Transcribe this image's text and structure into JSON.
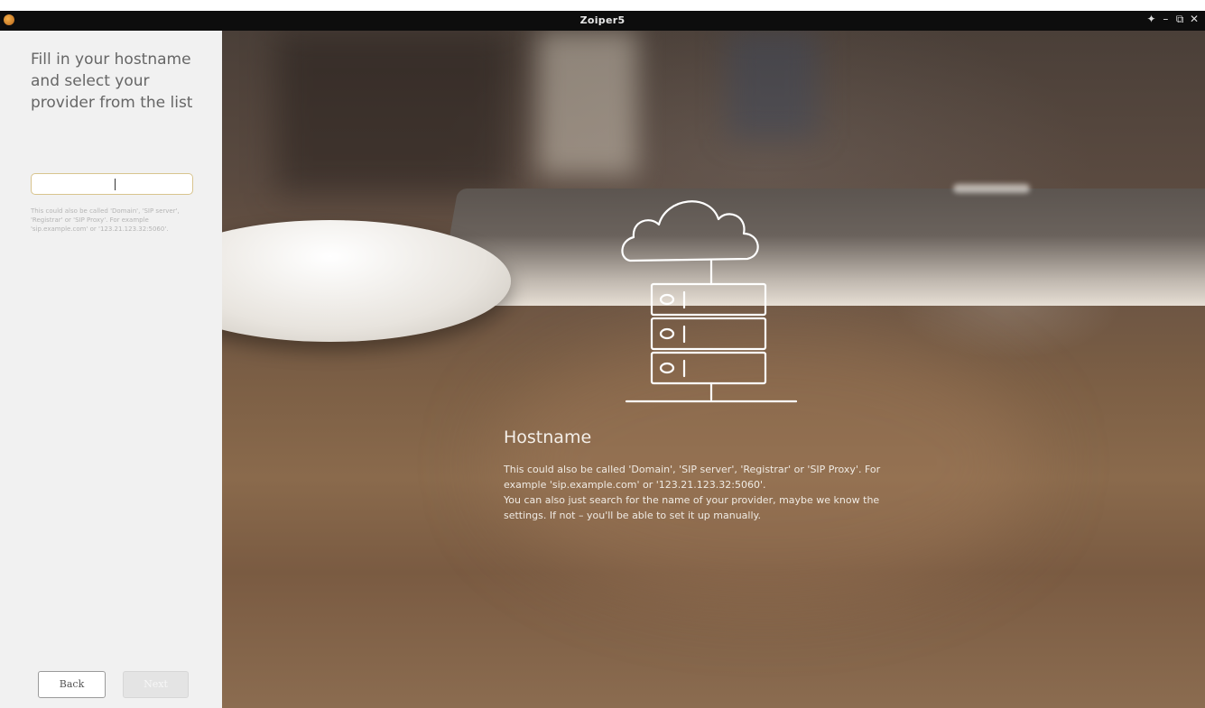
{
  "window": {
    "title": "Zoiper5",
    "controls": [
      "pin-icon",
      "minimize-icon",
      "restore-icon",
      "close-icon"
    ],
    "control_glyphs": [
      "✦",
      "–",
      "⧉",
      "✕"
    ]
  },
  "sidebar": {
    "heading": "Fill in your hostname and select your provider from the list",
    "hostname_input": {
      "value": "",
      "placeholder": ""
    },
    "hint": "This could also be called 'Domain', 'SIP server', 'Registrar' or 'SIP Proxy'. For example 'sip.example.com' or '123.21.123.32:5060'.",
    "back_label": "Back",
    "next_label": "Next"
  },
  "main": {
    "illustration": "cloud-server-icon",
    "title": "Hostname",
    "description": "This could also be called 'Domain', 'SIP server', 'Registrar' or 'SIP Proxy'. For example 'sip.example.com' or '123.21.123.32:5060'.\nYou can also just search for the name of your provider, maybe we know the settings. If not – you'll be able to set it up manually."
  },
  "colors": {
    "accent_input_border": "#d8c48e",
    "sidebar_bg": "#f1f1f1",
    "titlebar_bg": "#0d0d0d"
  }
}
